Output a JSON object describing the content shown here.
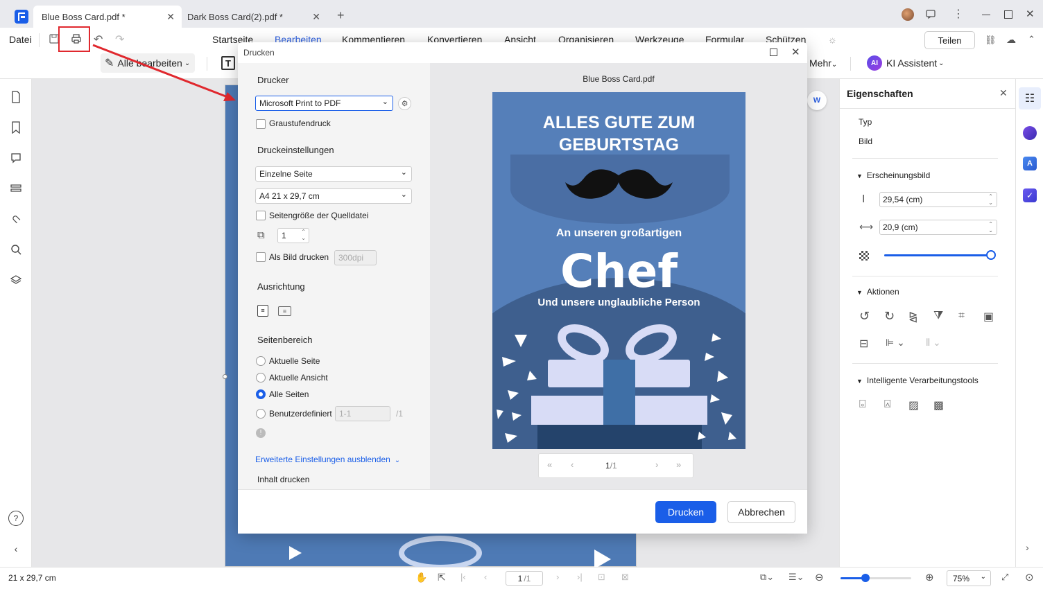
{
  "tabs": [
    {
      "label": "Blue Boss Card.pdf *"
    },
    {
      "label": "Dark Boss Card(2).pdf *"
    }
  ],
  "ribbon": {
    "file_menu": "Datei",
    "menus": [
      "Startseite",
      "Bearbeiten",
      "Kommentieren",
      "Konvertieren",
      "Ansicht",
      "Organisieren",
      "Werkzeuge",
      "Formular",
      "Schützen"
    ],
    "share_label": "Teilen",
    "edit_all_label": "Alle bearbeiten",
    "more_label": "Mehr",
    "ai_badge": "AI",
    "ai_label": "KI Assistent"
  },
  "dialog": {
    "title": "Drucken",
    "printer_section": "Drucker",
    "printer_value": "Microsoft Print to PDF",
    "grayscale_label": "Graustufendruck",
    "settings_section": "Druckeinstellungen",
    "page_mode_value": "Einzelne Seite",
    "paper_value": "A4 21 x 29,7 cm",
    "source_size_label": "Seitengröße der Quelldatei",
    "copies_value": "1",
    "as_image_label": "Als Bild drucken",
    "dpi_value": "300dpi",
    "orientation_section": "Ausrichtung",
    "range_section": "Seitenbereich",
    "range_options": [
      "Aktuelle Seite",
      "Aktuelle Ansicht",
      "Alle Seiten",
      "Benutzerdefiniert"
    ],
    "custom_range_placeholder": "1-1",
    "custom_range_total": "/1",
    "advanced_toggle": "Erweiterte Einstellungen ausblenden",
    "content_print_label": "Inhalt drucken",
    "preview_filename": "Blue Boss Card.pdf",
    "preview_page": "1",
    "preview_total": "/1",
    "print_button": "Drucken",
    "cancel_button": "Abbrechen"
  },
  "card": {
    "title_line1": "ALLES GUTE ZUM",
    "title_line2": "GEBURTSTAG",
    "subtitle": "An unseren großartigen",
    "big_word": "Chef",
    "tagline": "Und unsere unglaubliche Person"
  },
  "properties": {
    "title": "Eigenschaften",
    "type_label": "Typ",
    "type_value": "Bild",
    "appearance_section": "Erscheinungsbild",
    "height_value": "29,54 (cm)",
    "width_value": "20,9 (cm)",
    "opacity_level": 1.0,
    "actions_section": "Aktionen",
    "smart_tools_section": "Intelligente Verarbeitungstools"
  },
  "status": {
    "page_size": "21 x 29,7 cm",
    "page_current": "1",
    "page_total": "/1",
    "zoom_value": "75%",
    "zoom_level": 0.35
  },
  "colors": {
    "accent": "#1a5ee8",
    "card_blue": "#4e7ab5",
    "card_dark": "#3e5f8e",
    "annotation_red": "#e0282e"
  }
}
